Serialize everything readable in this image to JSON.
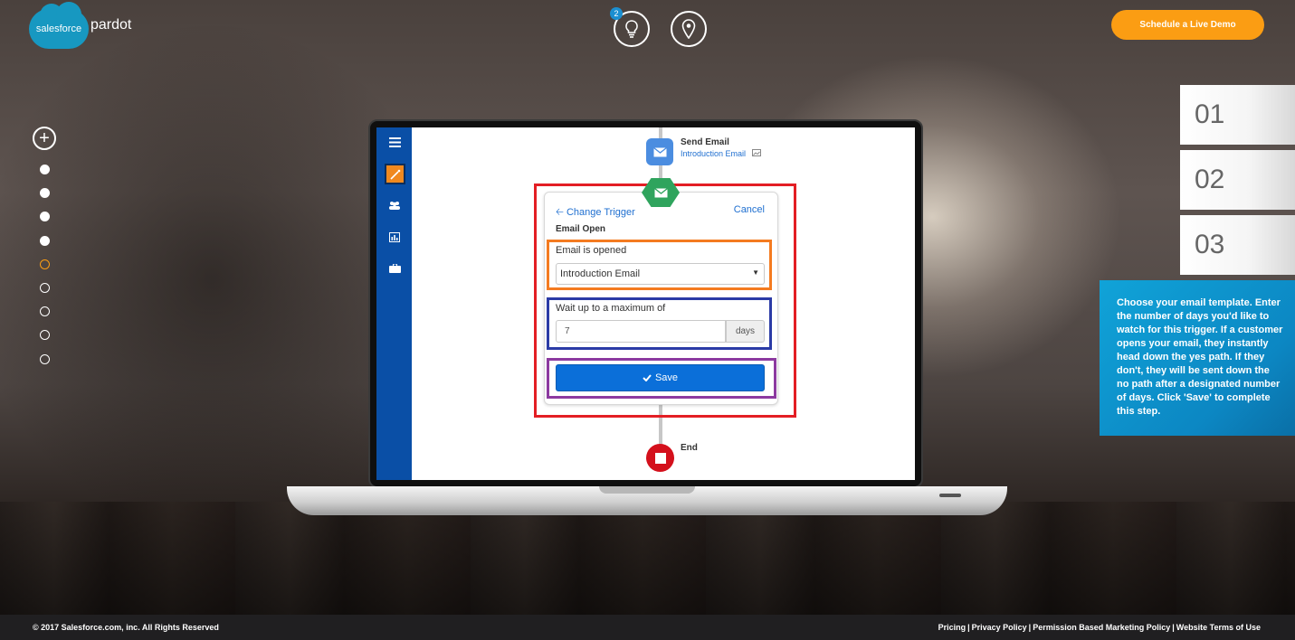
{
  "header": {
    "logo_cloud_text": "salesforce",
    "logo_text": "pardot",
    "tips_badge": "2",
    "tips_icon": "lightbulb-icon",
    "location_icon": "map-pin-icon",
    "demo_button": "Schedule a Live Demo"
  },
  "left_nav": {
    "add_icon": "plus-circle-icon",
    "dots": [
      {
        "state": "filled"
      },
      {
        "state": "filled"
      },
      {
        "state": "filled"
      },
      {
        "state": "filled"
      },
      {
        "state": "active"
      },
      {
        "state": "hollow"
      },
      {
        "state": "hollow"
      },
      {
        "state": "hollow"
      },
      {
        "state": "hollow"
      }
    ]
  },
  "app": {
    "sidebar_icons": [
      "menu-icon",
      "wand-icon",
      "users-icon",
      "report-icon",
      "briefcase-icon"
    ],
    "send_email_node": {
      "title": "Send Email",
      "subtitle": "Introduction Email"
    },
    "trigger_panel": {
      "change_trigger": "Change Trigger",
      "cancel": "Cancel",
      "title": "Email Open",
      "email_label": "Email is opened",
      "email_value": "Introduction Email",
      "wait_label": "Wait up to a maximum of",
      "wait_value": "7",
      "wait_unit": "days",
      "save": "Save"
    },
    "end_node": {
      "label": "End"
    }
  },
  "steps": [
    "01",
    "02",
    "03"
  ],
  "info_text": "Choose your email template. Enter the number of days you'd like to watch for this trigger. If a customer opens your email, they instantly head down the yes path. If they don't, they will be sent down the no path after a designated number of days. Click 'Save' to complete this step.",
  "footer": {
    "copyright": "© 2017 Salesforce.com, inc. All Rights Reserved",
    "links": [
      "Pricing",
      "Privacy Policy",
      "Permission Based Marketing Policy",
      "Website Terms of Use"
    ],
    "separator": "|"
  },
  "colors": {
    "accent_orange": "#fb9d13",
    "sidebar_blue": "#0a4fa6",
    "save_blue": "#0b6fd9",
    "info_blue": "#10a3d8",
    "highlight_red": "#e31e24",
    "highlight_orange": "#f47b20",
    "highlight_blue": "#2b3ba6",
    "highlight_purple": "#8c3aa0"
  }
}
